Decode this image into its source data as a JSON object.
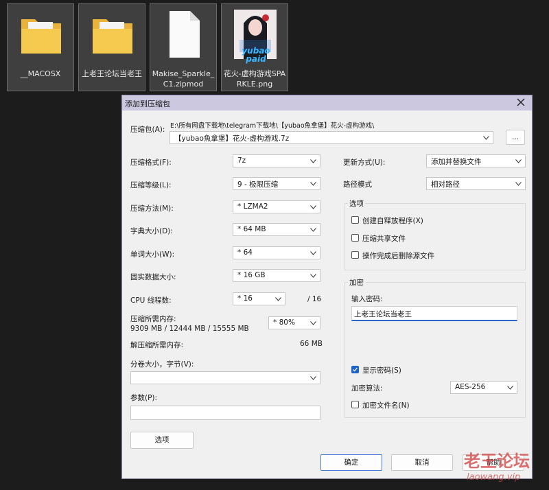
{
  "desktop": {
    "files": [
      {
        "name": "__MACOSX",
        "kind": "folder",
        "selected": true
      },
      {
        "name": "上老王论坛当老王",
        "kind": "folder",
        "selected": true
      },
      {
        "name": "Makise_Sparkle_C1.zipmod",
        "kind": "file",
        "selected": true
      },
      {
        "name": "花火-虚构游戏SPARKLE.png",
        "kind": "image",
        "selected": true,
        "thumb_text": "yubao paid"
      }
    ]
  },
  "dialog": {
    "title": "添加到压缩包",
    "archive": {
      "label": "压缩包(A):",
      "path": "E:\\所有网盘下载地\\telegram下载地\\【yubao魚拿堡】花火-虚构游戏\\",
      "name": "【yubao魚拿堡】花火-虚构游戏.7z",
      "browse_label": "..."
    },
    "left": {
      "format": {
        "label": "压缩格式(F):",
        "value": "7z"
      },
      "level": {
        "label": "压缩等级(L):",
        "value": "9 - 极限压缩"
      },
      "method": {
        "label": "压缩方法(M):",
        "value": "*  LZMA2"
      },
      "dict": {
        "label": "字典大小(D):",
        "value": "*  64 MB"
      },
      "word": {
        "label": "单词大小(W):",
        "value": "*  64"
      },
      "solid": {
        "label": "固实数据大小:",
        "value": "*  16 GB"
      },
      "cpu": {
        "label": "CPU 线程数:",
        "value": "*  16",
        "total": "/ 16"
      },
      "mem": {
        "label": "压缩所需内存:",
        "detail": "9309 MB / 12444 MB / 15555 MB",
        "value": "*  80%"
      },
      "decomp": {
        "label": "解压缩所需内存:",
        "value": "66 MB"
      },
      "split": {
        "label": "分卷大小，字节(V):",
        "value": ""
      },
      "params": {
        "label": "参数(P):",
        "value": ""
      },
      "options_button": "选项"
    },
    "right": {
      "update": {
        "label": "更新方式(U):",
        "value": "添加并替换文件"
      },
      "pathmode": {
        "label": "路径模式",
        "value": "相对路径"
      },
      "options": {
        "title": "选项",
        "items": [
          {
            "label": "创建自释放程序(X)",
            "checked": false
          },
          {
            "label": "压缩共享文件",
            "checked": false
          },
          {
            "label": "操作完成后删除源文件",
            "checked": false
          }
        ]
      },
      "encryption": {
        "title": "加密",
        "password_label": "输入密码:",
        "password": "上老王论坛当老王",
        "show_password": {
          "label": "显示密码(S)",
          "checked": true
        },
        "method_label": "加密算法:",
        "method": "AES-256",
        "encrypt_names": {
          "label": "加密文件名(N)",
          "checked": false
        }
      }
    },
    "buttons": {
      "ok": "确定",
      "cancel": "取消",
      "help": "帮助"
    }
  },
  "watermark": {
    "main": "老王论坛",
    "sub": "laowang.vip"
  }
}
